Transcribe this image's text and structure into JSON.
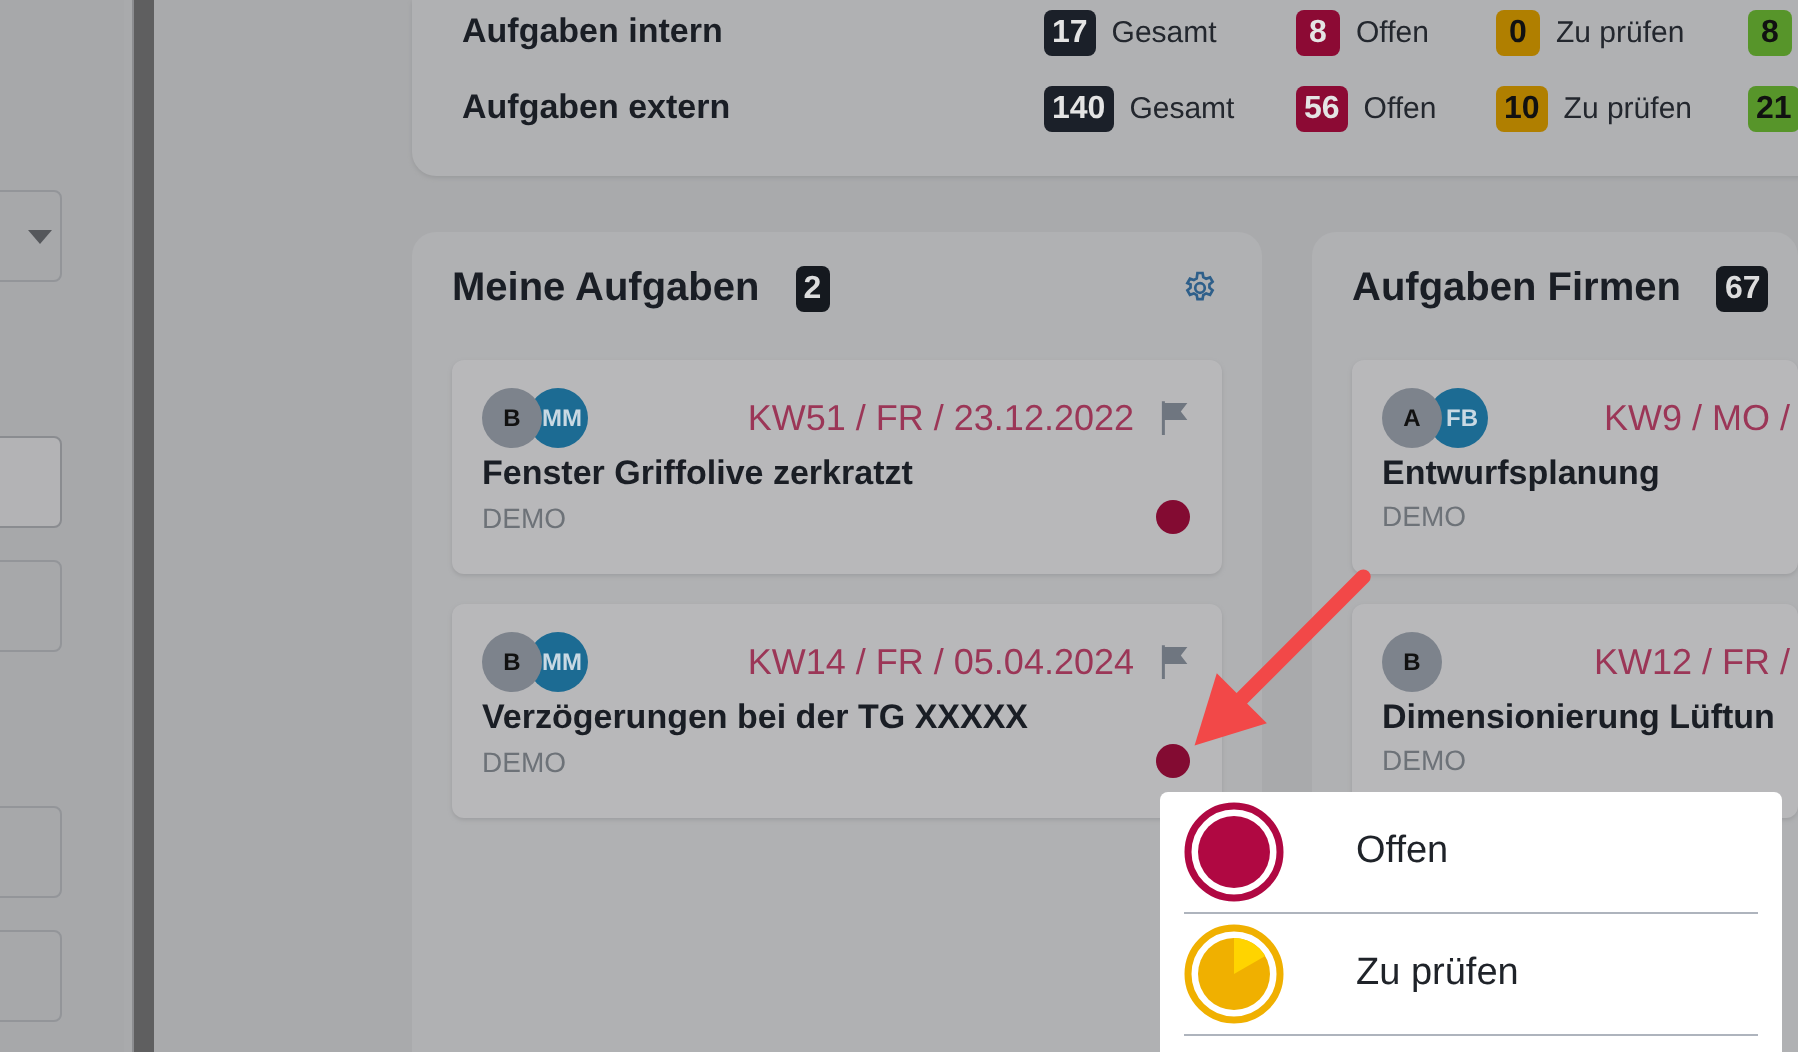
{
  "sidebar": {
    "fields": [
      {
        "kind": "dropdown"
      },
      {
        "kind": "filled"
      },
      {
        "kind": "empty"
      },
      {
        "kind": "empty"
      },
      {
        "kind": "empty"
      }
    ]
  },
  "summary": {
    "rows": [
      {
        "label": "Aufgaben intern",
        "counts": [
          {
            "value": "17",
            "label": "Gesamt",
            "color": "#1b2029"
          },
          {
            "value": "8",
            "label": "Offen",
            "color": "#8c0a34"
          },
          {
            "value": "0",
            "label": "Zu prüfen",
            "color": "#b07f00"
          },
          {
            "value": "8",
            "color": "#57952a"
          }
        ]
      },
      {
        "label": "Aufgaben extern",
        "counts": [
          {
            "value": "140",
            "label": "Gesamt",
            "color": "#1b2029"
          },
          {
            "value": "56",
            "label": "Offen",
            "color": "#8c0a34"
          },
          {
            "value": "10",
            "label": "Zu prüfen",
            "color": "#b07f00"
          },
          {
            "value": "21",
            "color": "#57952a"
          }
        ]
      }
    ]
  },
  "columns": [
    {
      "title": "Meine Aufgaben",
      "count": "2",
      "settings": true,
      "cards": [
        {
          "avatars": [
            {
              "initials": "B",
              "kind": "person"
            },
            {
              "initials": "MM",
              "kind": "company"
            }
          ],
          "due": "KW51 / FR / 23.12.2022",
          "flag": true,
          "title": "Fenster Griffolive zerkratzt",
          "project": "DEMO",
          "color": "#830b32"
        },
        {
          "avatars": [
            {
              "initials": "B",
              "kind": "person"
            },
            {
              "initials": "MM",
              "kind": "company"
            }
          ],
          "due": "KW14 / FR / 05.04.2024",
          "flag": true,
          "title": "Verzögerungen bei der TG XXXXX",
          "project": "DEMO",
          "color": "#830b32"
        }
      ]
    },
    {
      "title": "Aufgaben Firmen",
      "count": "67",
      "settings": false,
      "cards": [
        {
          "avatars": [
            {
              "initials": "A",
              "kind": "person"
            },
            {
              "initials": "FB",
              "kind": "company"
            }
          ],
          "due": "KW9 / MO /",
          "flag": false,
          "title": "Entwurfsplanung",
          "project": "DEMO"
        },
        {
          "avatars": [
            {
              "initials": "B",
              "kind": "person"
            }
          ],
          "due": "KW12 / FR /",
          "flag": false,
          "title": "Dimensionierung Lüftun",
          "project": "DEMO"
        }
      ]
    }
  ],
  "status_menu": {
    "items": [
      {
        "label": "Offen",
        "kind": "open"
      },
      {
        "label": "Zu prüfen",
        "kind": "review"
      }
    ]
  }
}
